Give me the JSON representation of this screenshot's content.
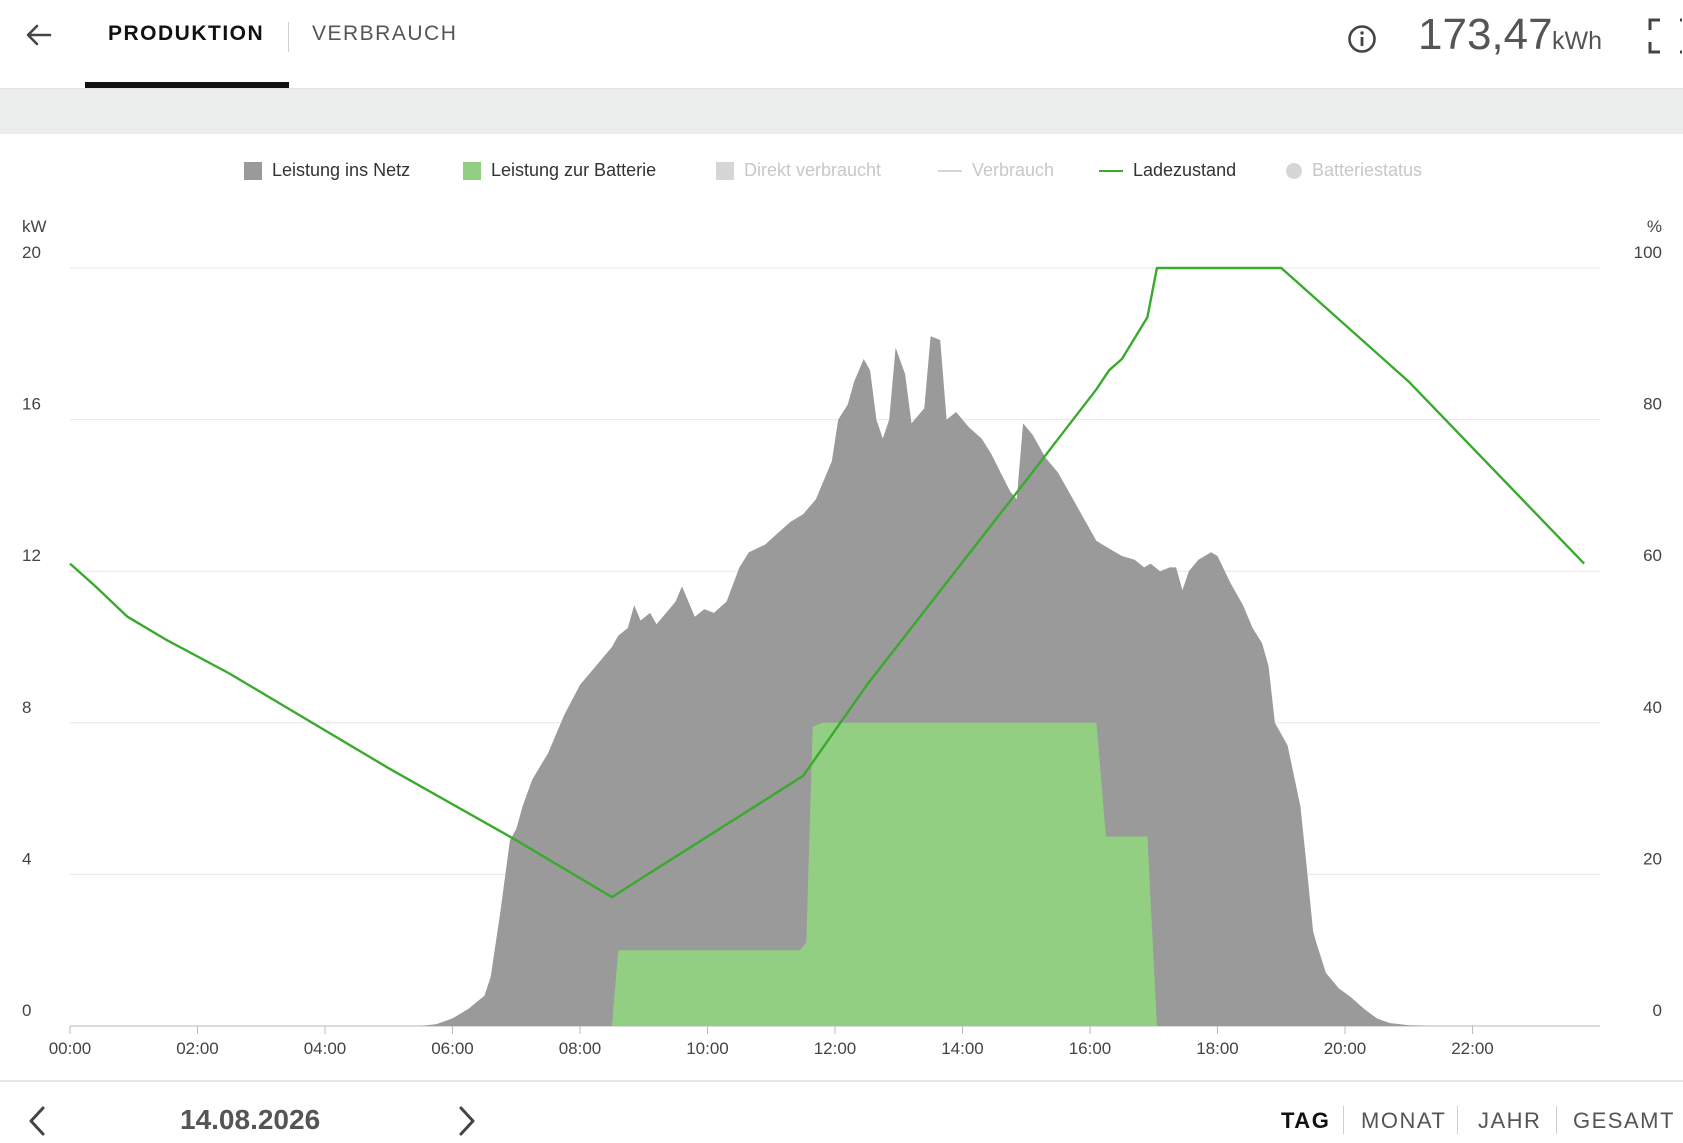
{
  "header": {
    "tabs": [
      {
        "label": "PRODUKTION",
        "active": true
      },
      {
        "label": "VERBRAUCH",
        "active": false
      }
    ],
    "total_value": "173,47",
    "total_unit": "kWh"
  },
  "icons": {
    "back": "arrow-left-icon",
    "info": "info-icon",
    "fullscreen": "fullscreen-icon",
    "prev": "chevron-left-icon",
    "next": "chevron-right-icon"
  },
  "legend": [
    {
      "label": "Leistung ins Netz",
      "color": "#9a9a9a",
      "active": true,
      "symbol": "square"
    },
    {
      "label": "Leistung zur Batterie",
      "color": "#92cf82",
      "active": true,
      "symbol": "square"
    },
    {
      "label": "Direkt verbraucht",
      "color": "#d6d6d6",
      "active": false,
      "symbol": "square"
    },
    {
      "label": "Verbrauch",
      "color": "#d6d6d6",
      "active": false,
      "symbol": "line"
    },
    {
      "label": "Ladezustand",
      "color": "#3aaa2e",
      "active": true,
      "symbol": "line"
    },
    {
      "label": "Batteriestatus",
      "color": "#d6d6d6",
      "active": false,
      "symbol": "dot"
    }
  ],
  "chart_data": {
    "type": "area",
    "y_left_label": "kW",
    "y_right_label": "%",
    "y_left_ticks": [
      "0",
      "4",
      "8",
      "12",
      "16",
      "20"
    ],
    "y_right_ticks": [
      "0",
      "20",
      "40",
      "60",
      "80",
      "100"
    ],
    "ylim_left": [
      0,
      20
    ],
    "ylim_right": [
      0,
      100
    ],
    "xlim": [
      0,
      24
    ],
    "x_ticks": [
      "00:00",
      "02:00",
      "04:00",
      "06:00",
      "08:00",
      "10:00",
      "12:00",
      "14:00",
      "16:00",
      "18:00",
      "20:00",
      "22:00"
    ],
    "grid": true,
    "series": [
      {
        "name": "Leistung ins Netz",
        "unit": "kW",
        "axis": "left",
        "color": "#9a9a9a",
        "points": [
          [
            0,
            0
          ],
          [
            5.5,
            0
          ],
          [
            5.75,
            0.05
          ],
          [
            6.0,
            0.2
          ],
          [
            6.25,
            0.45
          ],
          [
            6.5,
            0.8
          ],
          [
            6.6,
            1.3
          ],
          [
            6.75,
            3.0
          ],
          [
            6.9,
            4.9
          ],
          [
            7.0,
            5.2
          ],
          [
            7.1,
            5.8
          ],
          [
            7.25,
            6.5
          ],
          [
            7.5,
            7.2
          ],
          [
            7.75,
            8.2
          ],
          [
            8.0,
            9.0
          ],
          [
            8.25,
            9.5
          ],
          [
            8.5,
            10.0
          ],
          [
            8.6,
            10.3
          ],
          [
            8.75,
            10.5
          ],
          [
            8.85,
            11.1
          ],
          [
            8.95,
            10.7
          ],
          [
            9.1,
            10.9
          ],
          [
            9.2,
            10.6
          ],
          [
            9.4,
            11.0
          ],
          [
            9.5,
            11.2
          ],
          [
            9.6,
            11.6
          ],
          [
            9.7,
            11.2
          ],
          [
            9.8,
            10.8
          ],
          [
            9.95,
            11.0
          ],
          [
            10.1,
            10.9
          ],
          [
            10.3,
            11.2
          ],
          [
            10.5,
            12.1
          ],
          [
            10.65,
            12.5
          ],
          [
            10.9,
            12.7
          ],
          [
            11.1,
            13.0
          ],
          [
            11.3,
            13.3
          ],
          [
            11.5,
            13.5
          ],
          [
            11.7,
            13.9
          ],
          [
            11.85,
            14.5
          ],
          [
            11.95,
            14.9
          ],
          [
            12.05,
            16.0
          ],
          [
            12.2,
            16.4
          ],
          [
            12.3,
            17.0
          ],
          [
            12.45,
            17.6
          ],
          [
            12.55,
            17.3
          ],
          [
            12.65,
            16.0
          ],
          [
            12.75,
            15.5
          ],
          [
            12.85,
            16.0
          ],
          [
            12.95,
            17.9
          ],
          [
            13.1,
            17.2
          ],
          [
            13.2,
            15.9
          ],
          [
            13.3,
            16.1
          ],
          [
            13.4,
            16.3
          ],
          [
            13.5,
            18.2
          ],
          [
            13.65,
            18.1
          ],
          [
            13.75,
            16.0
          ],
          [
            13.9,
            16.2
          ],
          [
            14.1,
            15.8
          ],
          [
            14.3,
            15.5
          ],
          [
            14.45,
            15.1
          ],
          [
            14.6,
            14.6
          ],
          [
            14.75,
            14.1
          ],
          [
            14.85,
            13.9
          ],
          [
            14.95,
            15.9
          ],
          [
            15.1,
            15.6
          ],
          [
            15.3,
            15.0
          ],
          [
            15.5,
            14.6
          ],
          [
            15.7,
            14.0
          ],
          [
            15.9,
            13.4
          ],
          [
            16.1,
            12.8
          ],
          [
            16.3,
            12.6
          ],
          [
            16.5,
            12.4
          ],
          [
            16.7,
            12.3
          ],
          [
            16.85,
            12.1
          ],
          [
            16.95,
            12.2
          ],
          [
            17.1,
            12.0
          ],
          [
            17.25,
            12.1
          ],
          [
            17.35,
            12.1
          ],
          [
            17.45,
            11.5
          ],
          [
            17.55,
            12.0
          ],
          [
            17.7,
            12.3
          ],
          [
            17.9,
            12.5
          ],
          [
            18.0,
            12.4
          ],
          [
            18.2,
            11.7
          ],
          [
            18.4,
            11.1
          ],
          [
            18.55,
            10.5
          ],
          [
            18.7,
            10.1
          ],
          [
            18.8,
            9.5
          ],
          [
            18.9,
            8.0
          ],
          [
            19.1,
            7.4
          ],
          [
            19.3,
            5.8
          ],
          [
            19.4,
            4.2
          ],
          [
            19.5,
            2.5
          ],
          [
            19.55,
            2.2
          ],
          [
            19.7,
            1.4
          ],
          [
            19.9,
            1.0
          ],
          [
            20.1,
            0.75
          ],
          [
            20.3,
            0.45
          ],
          [
            20.5,
            0.2
          ],
          [
            20.7,
            0.08
          ],
          [
            21.0,
            0.02
          ],
          [
            21.3,
            0
          ],
          [
            24,
            0
          ]
        ]
      },
      {
        "name": "Leistung zur Batterie",
        "unit": "kW",
        "axis": "left",
        "color": "#92cf82",
        "points": [
          [
            0,
            0
          ],
          [
            8.5,
            0
          ],
          [
            8.6,
            2.0
          ],
          [
            11.45,
            2.0
          ],
          [
            11.55,
            2.2
          ],
          [
            11.65,
            7.9
          ],
          [
            11.8,
            8.0
          ],
          [
            16.1,
            8.0
          ],
          [
            16.25,
            5.0
          ],
          [
            16.9,
            5.0
          ],
          [
            17.05,
            0
          ],
          [
            24,
            0
          ]
        ]
      },
      {
        "name": "Ladezustand",
        "unit": "%",
        "axis": "right",
        "color": "#3aaa2e",
        "points": [
          [
            0,
            61
          ],
          [
            0.4,
            58
          ],
          [
            0.9,
            54
          ],
          [
            1.5,
            51
          ],
          [
            2.5,
            46.5
          ],
          [
            5.0,
            34
          ],
          [
            7.0,
            24.5
          ],
          [
            8.5,
            17
          ],
          [
            11.5,
            33
          ],
          [
            12.5,
            45
          ],
          [
            15.0,
            72
          ],
          [
            16.1,
            84
          ],
          [
            16.3,
            86.5
          ],
          [
            16.5,
            88
          ],
          [
            16.9,
            93.5
          ],
          [
            17.05,
            100
          ],
          [
            19.0,
            100
          ],
          [
            21.0,
            85
          ],
          [
            23.75,
            61
          ]
        ]
      }
    ]
  },
  "footer": {
    "date": "14.08.2026",
    "periods": [
      {
        "label": "TAG",
        "active": true
      },
      {
        "label": "MONAT",
        "active": false
      },
      {
        "label": "JAHR",
        "active": false
      },
      {
        "label": "GESAMT",
        "active": false
      }
    ]
  }
}
